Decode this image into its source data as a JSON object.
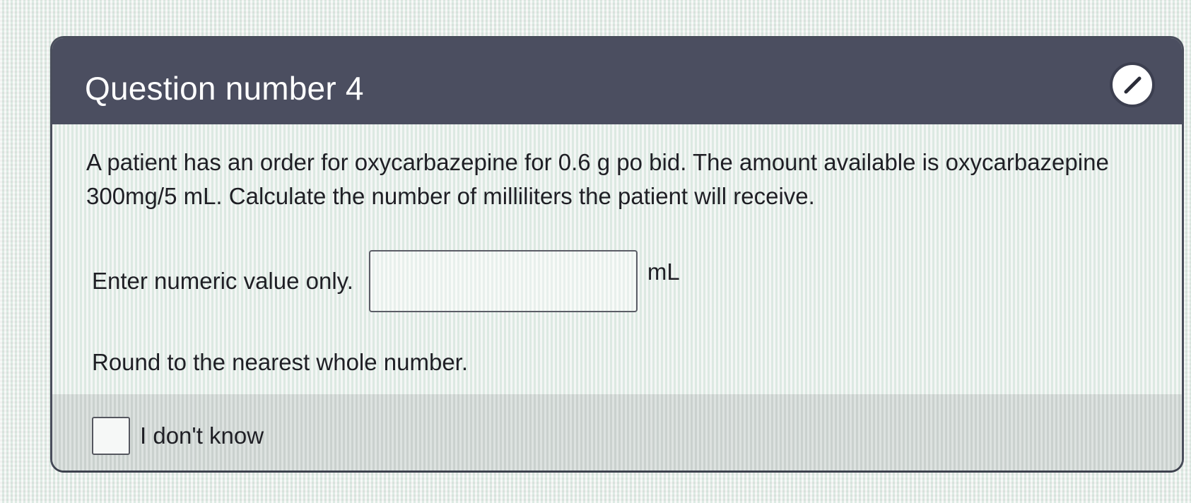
{
  "header": {
    "title": "Question number 4",
    "edit_icon": "pencil-icon"
  },
  "question": {
    "text": "A patient has an order for oxycarbazepine for 0.6 g po bid.  The amount available is oxycarbazepine 300mg/5 mL.  Calculate the number of milliliters the patient will receive.",
    "input_label": "Enter numeric value only.",
    "input_value": "",
    "unit": "mL",
    "instruction": "Round to the nearest whole number."
  },
  "footer": {
    "dont_know_label": "I don't know",
    "dont_know_checked": false
  },
  "colors": {
    "header_bg": "#4b4e60",
    "body_bg": "#e9eeeb",
    "footer_bg": "#cfd5d2"
  }
}
